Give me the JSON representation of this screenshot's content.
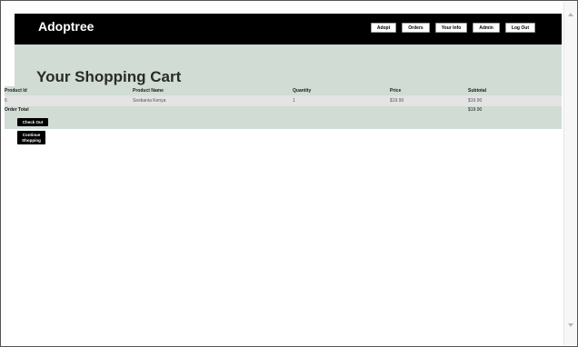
{
  "header": {
    "brand": "Adoptree",
    "nav": [
      "Adopt",
      "Orders",
      "Your Info",
      "Admin",
      "Log Out"
    ]
  },
  "banner": {
    "title": "Your Shopping Cart"
  },
  "cart": {
    "columns": [
      "Product Id",
      "Product Name",
      "Quantity",
      "Price",
      "Subtotal"
    ],
    "rows": [
      {
        "id": "6",
        "name": "Sesbania Kenya",
        "quantity": "1",
        "price": "$19.90",
        "subtotal": "$19.90"
      }
    ],
    "order_total_label": "Order Total",
    "order_total_value": "$19.90"
  },
  "actions": {
    "checkout_label": "Check Out",
    "continue_line1": "Continue",
    "continue_line2": "Shopping"
  }
}
